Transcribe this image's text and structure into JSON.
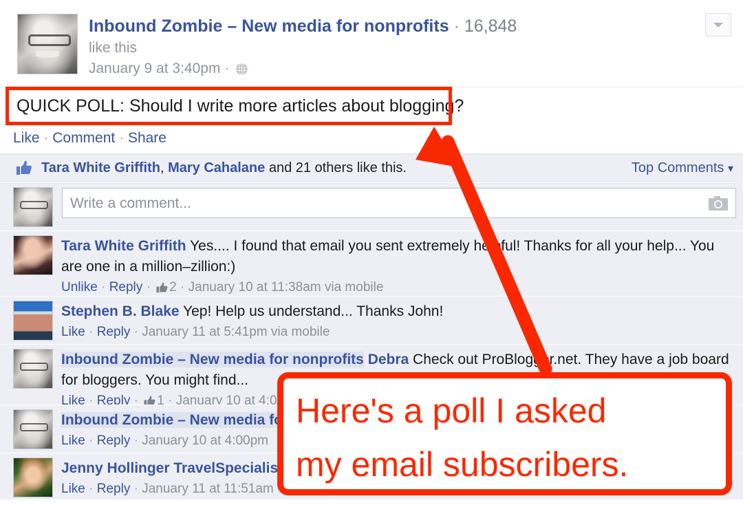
{
  "post": {
    "author": "Inbound Zombie – New media for nonprofits",
    "separator": "·",
    "like_count": "16,848",
    "like_this_label": "like this",
    "timestamp": "January 9 at 3:40pm",
    "privacy_icon": "globe-icon",
    "menu_icon": "chevron-down-icon",
    "message": "QUICK POLL: Should I write more articles about blogging?"
  },
  "actions": {
    "like": "Like",
    "comment": "Comment",
    "share": "Share",
    "dot": "·"
  },
  "likes_bar": {
    "thumb_icon": "thumbs-up-icon",
    "name1": "Tara White Griffith",
    "comma": ", ",
    "name2": "Mary Cahalane",
    "tail": " and 21 others like this.",
    "others_count": "21",
    "sort_label": "Top Comments",
    "sort_caret": "▾"
  },
  "compose": {
    "placeholder": "Write a comment...",
    "camera_icon": "camera-icon"
  },
  "comments": [
    {
      "author": "Tara White Griffith",
      "tagged": "",
      "text": " Yes.... I found that email you sent extremely helpful! Thanks for all your help... You are one in a million–zillion:)",
      "like_label": "Unlike",
      "reply_label": "Reply",
      "like_count": "2",
      "has_likes": true,
      "timestamp": "January 10 at 11:38am via mobile",
      "avatar": "av-tara"
    },
    {
      "author": "Stephen B. Blake",
      "tagged": "",
      "text": " Yep! Help us understand... Thanks John!",
      "like_label": "Like",
      "reply_label": "Reply",
      "like_count": "",
      "has_likes": false,
      "timestamp": "January 11 at 5:41pm via mobile",
      "avatar": "av-steve"
    },
    {
      "author": "Inbound Zombie – New media for nonprofits",
      "tagged": "Debra",
      "text": " Check out ProBlogger.net. They have a job board for bloggers. You might find...",
      "like_label": "Like",
      "reply_label": "Reply",
      "like_count": "1",
      "has_likes": true,
      "timestamp": "January 10 at 4:0...",
      "avatar": "av-john"
    },
    {
      "author": "Inbound Zombie – New media fo",
      "tagged": "",
      "text": "",
      "like_label": "Like",
      "reply_label": "Reply",
      "like_count": "",
      "has_likes": false,
      "timestamp": "January 10 at 4:00pm",
      "avatar": "av-john"
    },
    {
      "author": "Jenny Hollinger TravelSpecialist",
      "tagged": "",
      "text": "",
      "like_label": "Like",
      "reply_label": "Reply",
      "like_count": "",
      "has_likes": false,
      "timestamp": "January 11 at 11:51am",
      "avatar": "av-jenny"
    }
  ],
  "annotation": {
    "color": "#fa2800",
    "line1": "Here's a poll I asked",
    "line2": "my email subscribers.",
    "arrow_icon": "arrow-up-left-icon",
    "highlight_icon": "highlight-rectangle"
  }
}
